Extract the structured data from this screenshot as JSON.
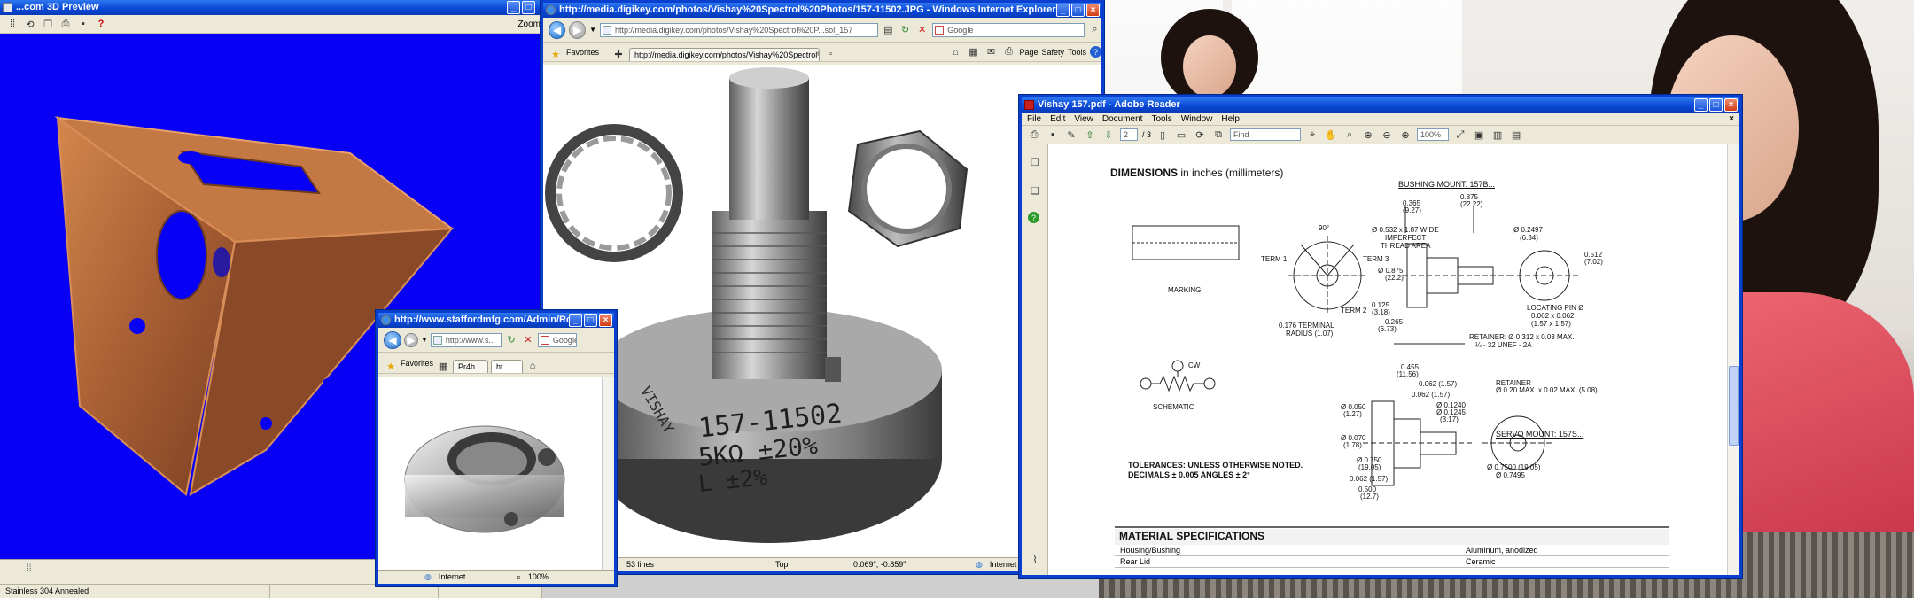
{
  "preview": {
    "title": "...com 3D Preview",
    "zoom_label": "Zoom",
    "status": "Stainless 304 Annealed"
  },
  "ie_main": {
    "title": "http://media.digikey.com/photos/Vishay%20Spectrol%20Photos/157-11502.JPG - Windows Internet Explorer",
    "address": "http://media.digikey.com/photos/Vishay%20Spectrol%20P...sol_157",
    "search_placeholder": "Google",
    "favorites_label": "Favorites",
    "tab_label": "http://media.digikey.com/photos/Vishay%20Spectrol%20P...",
    "page_menu": "Page",
    "safety_menu": "Safety",
    "tools_menu": "Tools",
    "help_glyph": "?",
    "status_zone": "Internet",
    "status_lines": "53 lines",
    "status_top": "Top",
    "status_coords": "0.069\", -0.859\"",
    "part_text": {
      "line1": "157-11502",
      "line2": "5KΩ ±20%",
      "line3": "L ±2%",
      "brand": "VISHAY"
    }
  },
  "ie_small": {
    "title": "http://www.staffordmfg.com/Admin/Ro...",
    "address": "http://www.s...",
    "search_placeholder": "Google",
    "favorites_label": "Favorites",
    "tab_label": "Pr4h...",
    "tab_label_2": "ht...",
    "status_zone": "Internet",
    "zoom": "100%"
  },
  "reader": {
    "title": "Vishay 157.pdf - Adobe Reader",
    "menus": [
      "File",
      "Edit",
      "View",
      "Document",
      "Tools",
      "Window",
      "Help"
    ],
    "page_current": "2",
    "page_total": "/ 3",
    "zoom": "100%",
    "find_placeholder": "Find",
    "doc": {
      "dim_heading": "DIMENSIONS",
      "dim_units": "in inches (millimeters)",
      "bushing_mount": "BUSHING MOUNT: 157B...",
      "servo_mount": "SERVO MOUNT: 157S...",
      "marking": "MARKING",
      "term1": "TERM 1",
      "term2": "TERM 2",
      "term3": "TERM 3",
      "angle": "90°",
      "wide_thread": "Ø 0.532 x 1.87 WIDE",
      "imperfect": "IMPERFECT",
      "thread_area": "THREAD AREA",
      "terminal_radius_1": "0.176 TERMINAL",
      "terminal_radius_2": "RADIUS (1.07)",
      "locating_pin": "LOCATING PIN Ø",
      "locating_pin_dim": "0.062 x 0.062",
      "locating_pin_mm": "(1.57 x 1.57)",
      "retainer_top": "RETAINER: Ø 0.312 x 0.03 MAX.",
      "thread_spec": "¼ - 32 UNEF - 2A",
      "schematic": "SCHEMATIC",
      "cw": "CW",
      "retainer_bottom_1": "RETAINER",
      "retainer_bottom_2": "Ø 0.20 MAX. x 0.02 MAX. (5.08)",
      "dim_365": "0.365",
      "dim_365_mm": "(9.27)",
      "dim_875": "0.875",
      "dim_875_mm": "(22.22)",
      "dim_2497": "Ø 0.2497",
      "dim_2497_mm": "(6.34)",
      "dim_512": "0.512",
      "dim_512_mm": "(7.02)",
      "dim_875b": "Ø 0.875",
      "dim_875b_mm": "(22.2)",
      "dim_125": "0.125",
      "dim_125_mm": "(3.18)",
      "dim_265": "0.265",
      "dim_265_mm": "(6.73)",
      "dim_455": "0.455",
      "dim_455_mm": "(11.56)",
      "dim_062a": "0.062 (1.57)",
      "dim_062b": "0.062 (1.57)",
      "dim_1240": "Ø 0.1240",
      "dim_1245": "Ø 0.1245",
      "dim_1245_mm": "(3.17)",
      "dim_050": "Ø 0.050",
      "dim_050_mm": "(1.27)",
      "dim_070": "Ø 0.070",
      "dim_070_mm": "(1.78)",
      "dim_750": "Ø 0.750",
      "dim_750_mm": "(19.05)",
      "dim_062c": "0.062 (1.57)",
      "dim_500": "0.500",
      "dim_500_mm": "(12.7)",
      "dim_7500": "Ø 0.7500 (19.05)",
      "dim_7495": "Ø 0.7495",
      "tolerances_1": "TOLERANCES: UNLESS OTHERWISE NOTED.",
      "tolerances_2": "DECIMALS ± 0.005 ANGLES ± 2°",
      "material_heading": "MATERIAL SPECIFICATIONS",
      "materials": [
        {
          "part": "Housing/Bushing",
          "spec": "Aluminum, anodized"
        },
        {
          "part": "Rear Lid",
          "spec": "Ceramic"
        }
      ]
    }
  },
  "colors": {
    "xp_title": "#0a49d8",
    "viewport_blue": "#0700f4",
    "bracket": "#b86a3c"
  }
}
